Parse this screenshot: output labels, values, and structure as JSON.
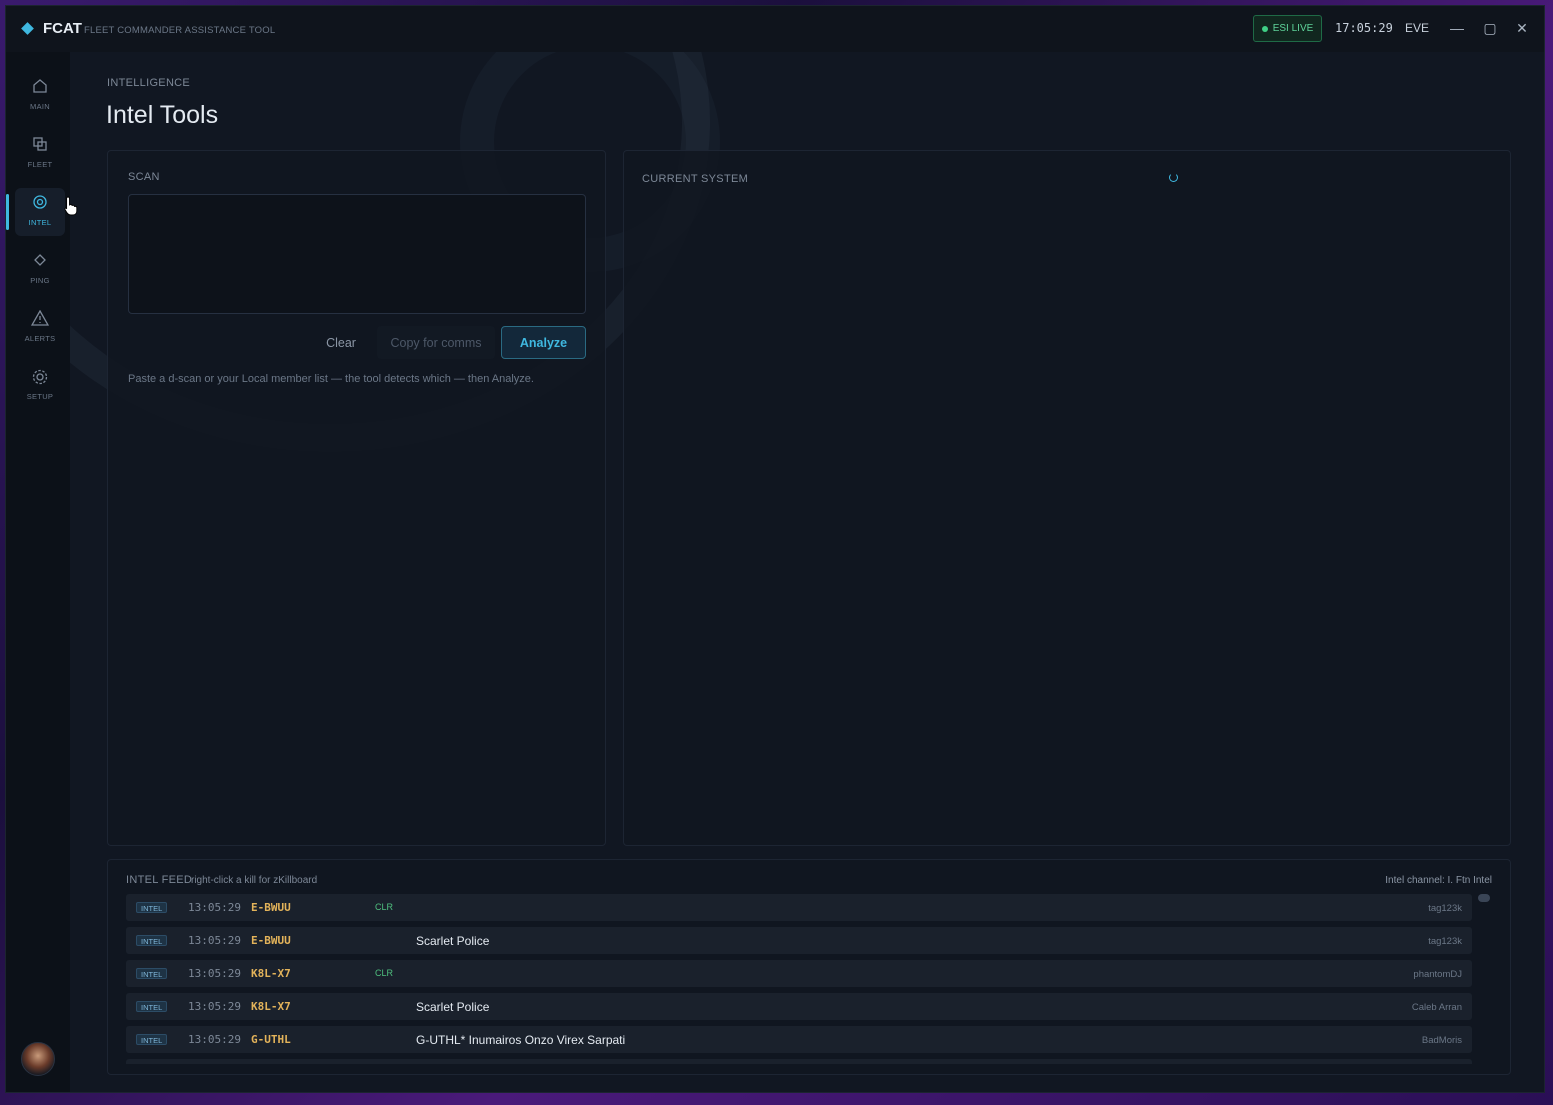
{
  "app": {
    "name": "FCAT",
    "subtitle": "FLEET COMMANDER ASSISTANCE TOOL",
    "status_badge": "ESI LIVE",
    "clock": "17:05:29",
    "server": "EVE",
    "accent_color": "#3fb8e0"
  },
  "window_controls": {
    "minimize": "—",
    "maximize": "▢",
    "close": "✕"
  },
  "sidebar": {
    "items": [
      {
        "label": "MAIN",
        "icon": "home-icon"
      },
      {
        "label": "FLEET",
        "icon": "fleet-icon"
      },
      {
        "label": "INTEL",
        "icon": "target-icon",
        "active": true
      },
      {
        "label": "PING",
        "icon": "diamond-icon"
      },
      {
        "label": "ALERTS",
        "icon": "warning-icon"
      },
      {
        "label": "SETUP",
        "icon": "gear-icon"
      }
    ]
  },
  "page": {
    "breadcrumb": "INTELLIGENCE",
    "title": "Intel Tools"
  },
  "scan": {
    "label": "SCAN",
    "input_value": "",
    "clear_label": "Clear",
    "copy_label": "Copy for comms",
    "analyze_label": "Analyze",
    "hint": "Paste a d-scan or your Local member list — the tool detects which — then Analyze."
  },
  "system": {
    "label": "CURRENT SYSTEM"
  },
  "feed": {
    "title": "INTEL FEED",
    "hint": "right-click a kill for zKillboard",
    "channel": "Intel channel: I. Ftn Intel",
    "rows": [
      {
        "tag": "INTEL",
        "time": "13:05:29",
        "system": "E-BWUU",
        "clr": "CLR",
        "message": "",
        "user": "tag123k"
      },
      {
        "tag": "INTEL",
        "time": "13:05:29",
        "system": "E-BWUU",
        "clr": "",
        "message": "Scarlet Police",
        "user": "tag123k"
      },
      {
        "tag": "INTEL",
        "time": "13:05:29",
        "system": "K8L-X7",
        "clr": "CLR",
        "message": "",
        "user": "phantomDJ"
      },
      {
        "tag": "INTEL",
        "time": "13:05:29",
        "system": "K8L-X7",
        "clr": "",
        "message": "Scarlet Police",
        "user": "Caleb Arran"
      },
      {
        "tag": "INTEL",
        "time": "13:05:29",
        "system": "G-UTHL",
        "clr": "",
        "message": "G-UTHL* Inumairos Onzo Virex Sarpati",
        "user": "BadMoris"
      }
    ]
  }
}
